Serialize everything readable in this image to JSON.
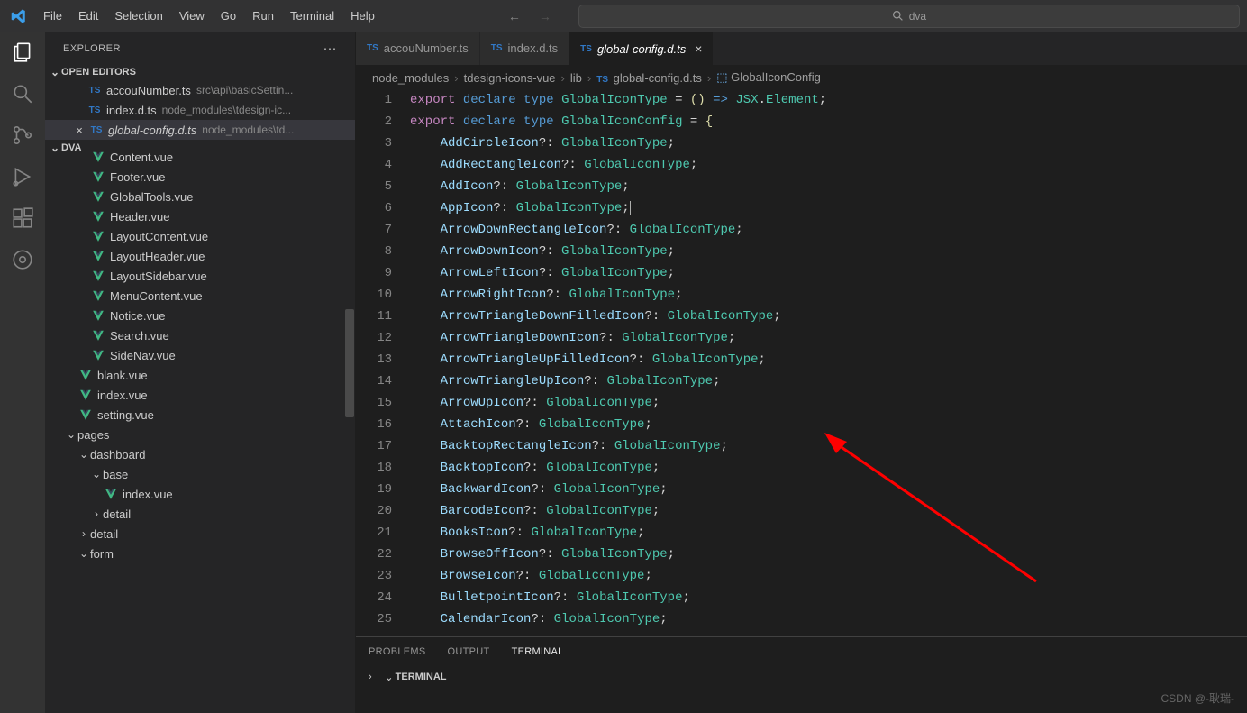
{
  "menu": [
    "File",
    "Edit",
    "Selection",
    "View",
    "Go",
    "Run",
    "Terminal",
    "Help"
  ],
  "search": {
    "placeholder": "dva"
  },
  "explorer": {
    "title": "EXPLORER",
    "openEditors": {
      "label": "OPEN EDITORS",
      "items": [
        {
          "icon": "TS",
          "name": "accouNumber.ts",
          "path": "src\\api\\basicSettin..."
        },
        {
          "icon": "TS",
          "name": "index.d.ts",
          "path": "node_modules\\tdesign-ic..."
        },
        {
          "icon": "TS",
          "name": "global-config.d.ts",
          "path": "node_modules\\td...",
          "italic": true,
          "active": true
        }
      ]
    },
    "project": {
      "label": "DVA",
      "files": [
        {
          "type": "vue",
          "name": "Content.vue",
          "indent": 3,
          "clipped": true
        },
        {
          "type": "vue",
          "name": "Footer.vue",
          "indent": 3
        },
        {
          "type": "vue",
          "name": "GlobalTools.vue",
          "indent": 3
        },
        {
          "type": "vue",
          "name": "Header.vue",
          "indent": 3
        },
        {
          "type": "vue",
          "name": "LayoutContent.vue",
          "indent": 3
        },
        {
          "type": "vue",
          "name": "LayoutHeader.vue",
          "indent": 3
        },
        {
          "type": "vue",
          "name": "LayoutSidebar.vue",
          "indent": 3
        },
        {
          "type": "vue",
          "name": "MenuContent.vue",
          "indent": 3
        },
        {
          "type": "vue",
          "name": "Notice.vue",
          "indent": 3
        },
        {
          "type": "vue",
          "name": "Search.vue",
          "indent": 3
        },
        {
          "type": "vue",
          "name": "SideNav.vue",
          "indent": 3
        },
        {
          "type": "vue",
          "name": "blank.vue",
          "indent": 2
        },
        {
          "type": "vue",
          "name": "index.vue",
          "indent": 2
        },
        {
          "type": "vue",
          "name": "setting.vue",
          "indent": 2
        },
        {
          "type": "folder-open",
          "name": "pages",
          "indent": 1
        },
        {
          "type": "folder-open",
          "name": "dashboard",
          "indent": 2
        },
        {
          "type": "folder-open",
          "name": "base",
          "indent": 3
        },
        {
          "type": "vue",
          "name": "index.vue",
          "indent": 4
        },
        {
          "type": "folder-closed",
          "name": "detail",
          "indent": 3
        },
        {
          "type": "folder-closed",
          "name": "detail",
          "indent": 2
        },
        {
          "type": "folder-open",
          "name": "form",
          "indent": 2
        }
      ]
    }
  },
  "tabs": [
    {
      "icon": "TS",
      "label": "accouNumber.ts",
      "active": false
    },
    {
      "icon": "TS",
      "label": "index.d.ts",
      "active": false
    },
    {
      "icon": "TS",
      "label": "global-config.d.ts",
      "active": true,
      "italic": true
    }
  ],
  "breadcrumb": [
    "node_modules",
    "tdesign-icons-vue",
    "lib",
    "global-config.d.ts",
    "GlobalIconConfig"
  ],
  "code": {
    "lines": [
      {
        "n": 1,
        "tokens": [
          [
            "k",
            "export"
          ],
          [
            "p",
            " "
          ],
          [
            "kw",
            "declare"
          ],
          [
            "p",
            " "
          ],
          [
            "kw",
            "type"
          ],
          [
            "p",
            " "
          ],
          [
            "t",
            "GlobalIconType"
          ],
          [
            "p",
            " = "
          ],
          [
            "y",
            "()"
          ],
          [
            "p",
            " "
          ],
          [
            "kw",
            "=>"
          ],
          [
            "p",
            " "
          ],
          [
            "n",
            "JSX"
          ],
          [
            "p",
            "."
          ],
          [
            "t",
            "Element"
          ],
          [
            "p",
            ";"
          ]
        ]
      },
      {
        "n": 2,
        "tokens": [
          [
            "k",
            "export"
          ],
          [
            "p",
            " "
          ],
          [
            "kw",
            "declare"
          ],
          [
            "p",
            " "
          ],
          [
            "kw",
            "type"
          ],
          [
            "p",
            " "
          ],
          [
            "t",
            "GlobalIconConfig"
          ],
          [
            "p",
            " = "
          ],
          [
            "y",
            "{"
          ]
        ]
      },
      {
        "n": 3,
        "ind": 1,
        "prop": "AddCircleIcon"
      },
      {
        "n": 4,
        "ind": 1,
        "prop": "AddRectangleIcon"
      },
      {
        "n": 5,
        "ind": 1,
        "prop": "AddIcon"
      },
      {
        "n": 6,
        "ind": 1,
        "prop": "AppIcon",
        "cursor": true
      },
      {
        "n": 7,
        "ind": 1,
        "prop": "ArrowDownRectangleIcon"
      },
      {
        "n": 8,
        "ind": 1,
        "prop": "ArrowDownIcon"
      },
      {
        "n": 9,
        "ind": 1,
        "prop": "ArrowLeftIcon"
      },
      {
        "n": 10,
        "ind": 1,
        "prop": "ArrowRightIcon"
      },
      {
        "n": 11,
        "ind": 1,
        "prop": "ArrowTriangleDownFilledIcon"
      },
      {
        "n": 12,
        "ind": 1,
        "prop": "ArrowTriangleDownIcon"
      },
      {
        "n": 13,
        "ind": 1,
        "prop": "ArrowTriangleUpFilledIcon"
      },
      {
        "n": 14,
        "ind": 1,
        "prop": "ArrowTriangleUpIcon"
      },
      {
        "n": 15,
        "ind": 1,
        "prop": "ArrowUpIcon"
      },
      {
        "n": 16,
        "ind": 1,
        "prop": "AttachIcon"
      },
      {
        "n": 17,
        "ind": 1,
        "prop": "BacktopRectangleIcon"
      },
      {
        "n": 18,
        "ind": 1,
        "prop": "BacktopIcon"
      },
      {
        "n": 19,
        "ind": 1,
        "prop": "BackwardIcon"
      },
      {
        "n": 20,
        "ind": 1,
        "prop": "BarcodeIcon"
      },
      {
        "n": 21,
        "ind": 1,
        "prop": "BooksIcon"
      },
      {
        "n": 22,
        "ind": 1,
        "prop": "BrowseOffIcon"
      },
      {
        "n": 23,
        "ind": 1,
        "prop": "BrowseIcon"
      },
      {
        "n": 24,
        "ind": 1,
        "prop": "BulletpointIcon"
      },
      {
        "n": 25,
        "ind": 1,
        "prop": "CalendarIcon"
      }
    ]
  },
  "panel": {
    "tabs": [
      "PROBLEMS",
      "OUTPUT",
      "TERMINAL"
    ],
    "activeTab": "TERMINAL",
    "terminalLabel": "TERMINAL"
  },
  "watermark": "CSDN @-耿瑞-"
}
